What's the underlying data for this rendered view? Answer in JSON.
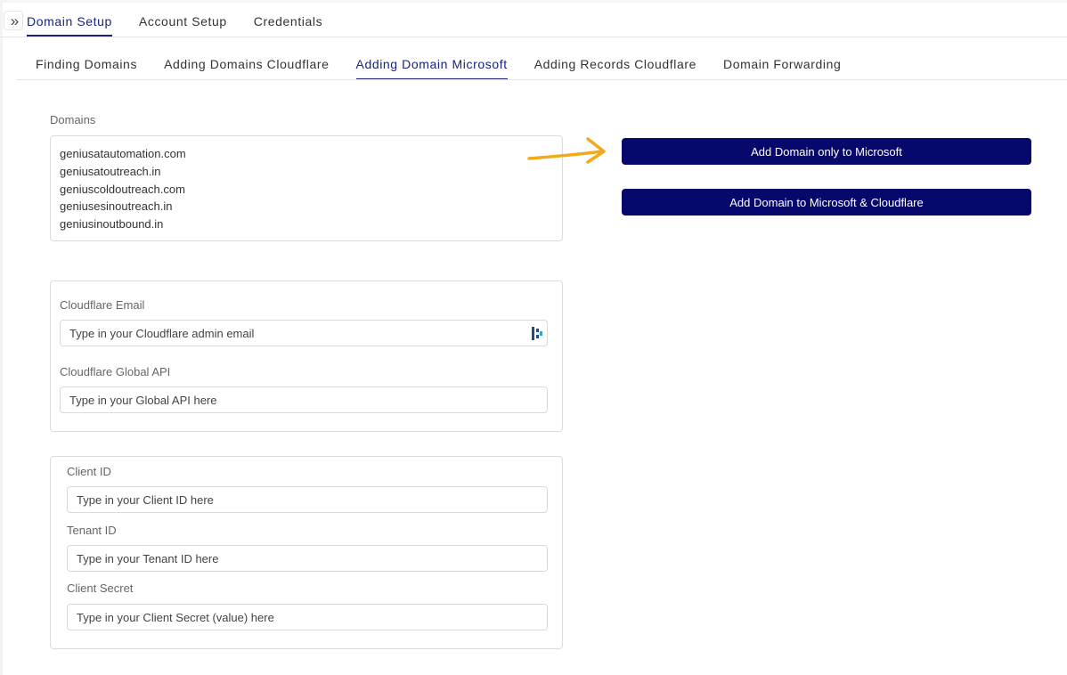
{
  "nav": {
    "expand_icon": "double-chevron-right-icon",
    "expand_glyph": "»",
    "main_tabs": [
      {
        "label": "Domain Setup",
        "active": true
      },
      {
        "label": "Account Setup",
        "active": false
      },
      {
        "label": "Credentials",
        "active": false
      }
    ],
    "sub_tabs": [
      {
        "label": "Finding Domains",
        "active": false
      },
      {
        "label": "Adding Domains Cloudflare",
        "active": false
      },
      {
        "label": "Adding Domain Microsoft",
        "active": true
      },
      {
        "label": "Adding Records Cloudflare",
        "active": false
      },
      {
        "label": "Domain Forwarding",
        "active": false
      }
    ]
  },
  "domains": {
    "label": "Domains",
    "list": [
      "geniusatautomation.com",
      "geniusatoutreach.in",
      "geniuscoldoutreach.com",
      "geniusesinoutreach.in",
      "geniusinoutbound.in"
    ]
  },
  "cloudflare": {
    "email_label": "Cloudflare Email",
    "email_placeholder": "Type in your Cloudflare admin email",
    "email_field_icon": "password-manager-icon",
    "api_label": "Cloudflare Global API",
    "api_placeholder": "Type in your Global API here"
  },
  "microsoft": {
    "client_id_label": "Client ID",
    "client_id_placeholder": "Type in your Client ID here",
    "tenant_id_label": "Tenant ID",
    "tenant_id_placeholder": "Type in your Tenant ID here",
    "client_secret_label": "Client Secret",
    "client_secret_placeholder": "Type in your Client Secret (value) here"
  },
  "actions": {
    "add_microsoft_only": "Add Domain only to Microsoft",
    "add_microsoft_cloudflare": "Add Domain to Microsoft & Cloudflare"
  },
  "annotation": {
    "arrow_icon": "arrow-right-icon",
    "arrow_color": "#f2a91c"
  },
  "colors": {
    "accent": "#1a237e",
    "button_bg": "#06096b",
    "button_text": "#ffffff"
  }
}
